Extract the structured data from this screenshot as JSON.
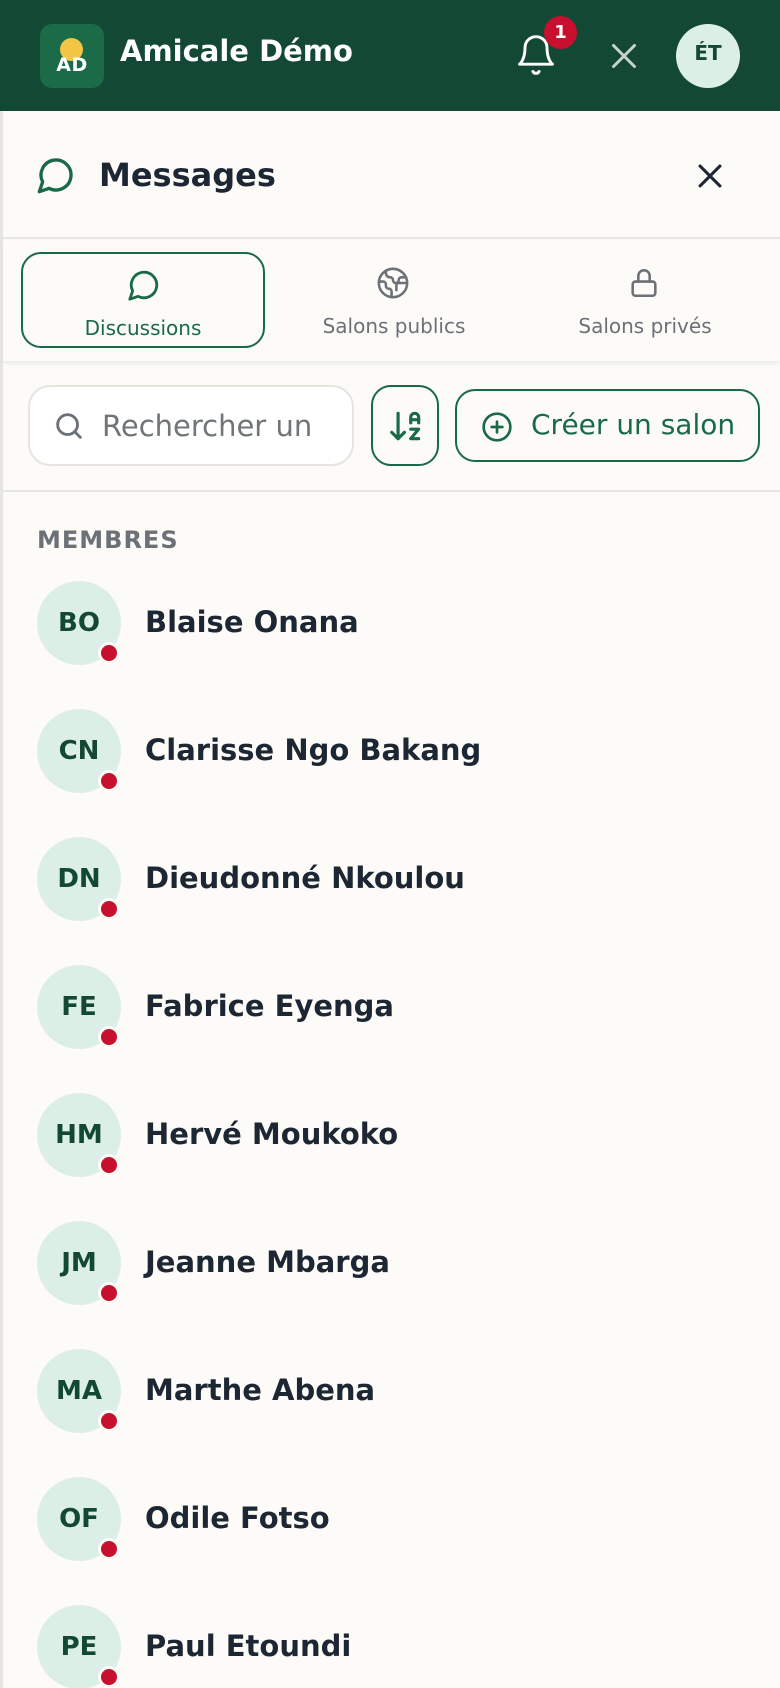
{
  "app": {
    "logo_initials": "AD",
    "title": "Amicale Démo",
    "notification_count": "1",
    "user_initials": "ÉT"
  },
  "panel": {
    "title": "Messages"
  },
  "tabs": [
    {
      "label": "Discussions",
      "icon": "chat-bubble-icon",
      "active": true
    },
    {
      "label": "Salons publics",
      "icon": "globe-icon",
      "active": false
    },
    {
      "label": "Salons privés",
      "icon": "lock-icon",
      "active": false
    }
  ],
  "toolbar": {
    "search_placeholder": "Rechercher un",
    "search_value": "",
    "sort_icon": "sort-az-icon",
    "create_label": "Créer un salon"
  },
  "members": {
    "section_label": "MEMBRES",
    "items": [
      {
        "initials": "BO",
        "name": "Blaise Onana",
        "status": "offline"
      },
      {
        "initials": "CN",
        "name": "Clarisse Ngo Bakang",
        "status": "offline"
      },
      {
        "initials": "DN",
        "name": "Dieudonné Nkoulou",
        "status": "offline"
      },
      {
        "initials": "FE",
        "name": "Fabrice Eyenga",
        "status": "offline"
      },
      {
        "initials": "HM",
        "name": "Hervé Moukoko",
        "status": "offline"
      },
      {
        "initials": "JM",
        "name": "Jeanne Mbarga",
        "status": "offline"
      },
      {
        "initials": "MA",
        "name": "Marthe Abena",
        "status": "offline"
      },
      {
        "initials": "OF",
        "name": "Odile Fotso",
        "status": "offline"
      },
      {
        "initials": "PE",
        "name": "Paul Etoundi",
        "status": "offline"
      }
    ]
  },
  "colors": {
    "brand_dark": "#134834",
    "accent": "#1a6a4a",
    "avatar_bg": "#dcefe6",
    "status_offline": "#c8102e",
    "logo_dot": "#f2c544"
  }
}
